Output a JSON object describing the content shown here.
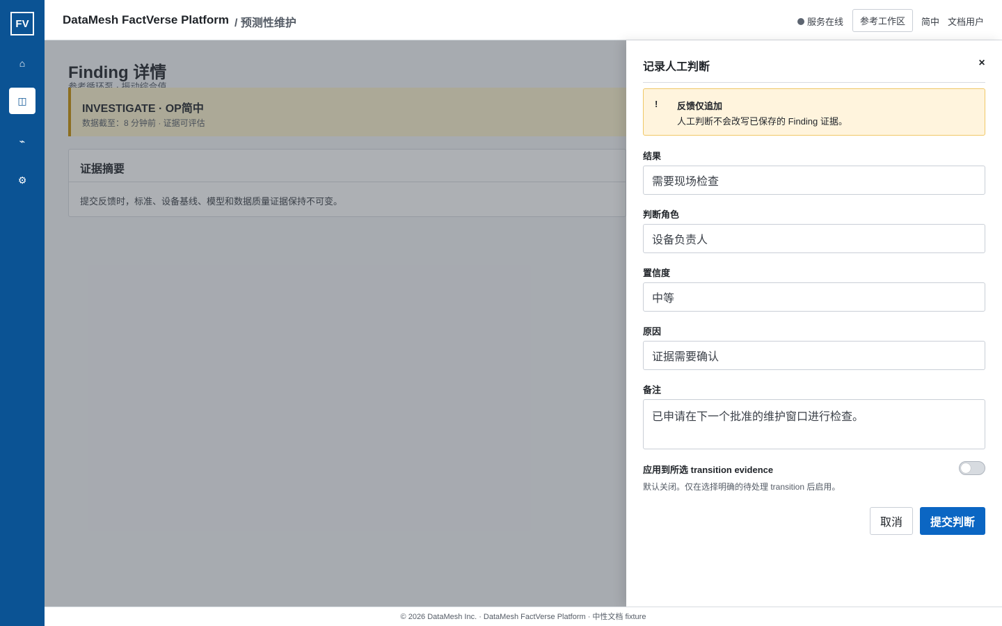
{
  "sidebar": {
    "logo": "FV",
    "items": [
      {
        "icon": "home-icon",
        "glyph": "⌂",
        "active": false
      },
      {
        "icon": "layout-icon",
        "glyph": "◫",
        "active": true
      },
      {
        "icon": "signal-icon",
        "glyph": "⌁",
        "active": false
      },
      {
        "icon": "gear-icon",
        "glyph": "⚙",
        "active": false
      }
    ]
  },
  "header": {
    "brand": "DataMesh FactVerse Platform",
    "breadcrumb": "/ 预测性维护",
    "status": "服务在线",
    "workspace_button": "参考工作区",
    "language": "简中",
    "user": "文档用户"
  },
  "page": {
    "title": "Finding 详情",
    "subtitle": "参考循环泵 · 振动综合值",
    "banner": {
      "title": "INVESTIGATE · OP简中",
      "meta": "数据截至：8 分钟前 · 证据可评估"
    },
    "card": {
      "title": "证据摘要",
      "body": "提交反馈时，标准、设备基线、模型和数据质量证据保持不可变。"
    }
  },
  "drawer": {
    "title": "记录人工判断",
    "close": "×",
    "notice": {
      "icon": "!",
      "title": "反馈仅追加",
      "text": "人工判断不会改写已保存的 Finding 证据。"
    },
    "fields": {
      "result": {
        "label": "结果",
        "value": "需要现场检查"
      },
      "role": {
        "label": "判断角色",
        "value": "设备负责人"
      },
      "confidence": {
        "label": "置信度",
        "value": "中等"
      },
      "reason": {
        "label": "原因",
        "value": "证据需要确认"
      },
      "notes": {
        "label": "备注",
        "value": "已申请在下一个批准的维护窗口进行检查。"
      }
    },
    "toggle": {
      "label": "应用到所选 transition evidence",
      "help": "默认关闭。仅在选择明确的待处理 transition 后启用。",
      "on": false
    },
    "cancel": "取消",
    "submit": "提交判断"
  },
  "footer": {
    "text": "© 2026 DataMesh Inc. · DataMesh FactVerse Platform · 中性文档 fixture"
  },
  "colors": {
    "brand": "#0b5394",
    "primary_button": "#0b66c3",
    "warning_border": "#c78d00",
    "notice_bg": "#fff4dd"
  }
}
